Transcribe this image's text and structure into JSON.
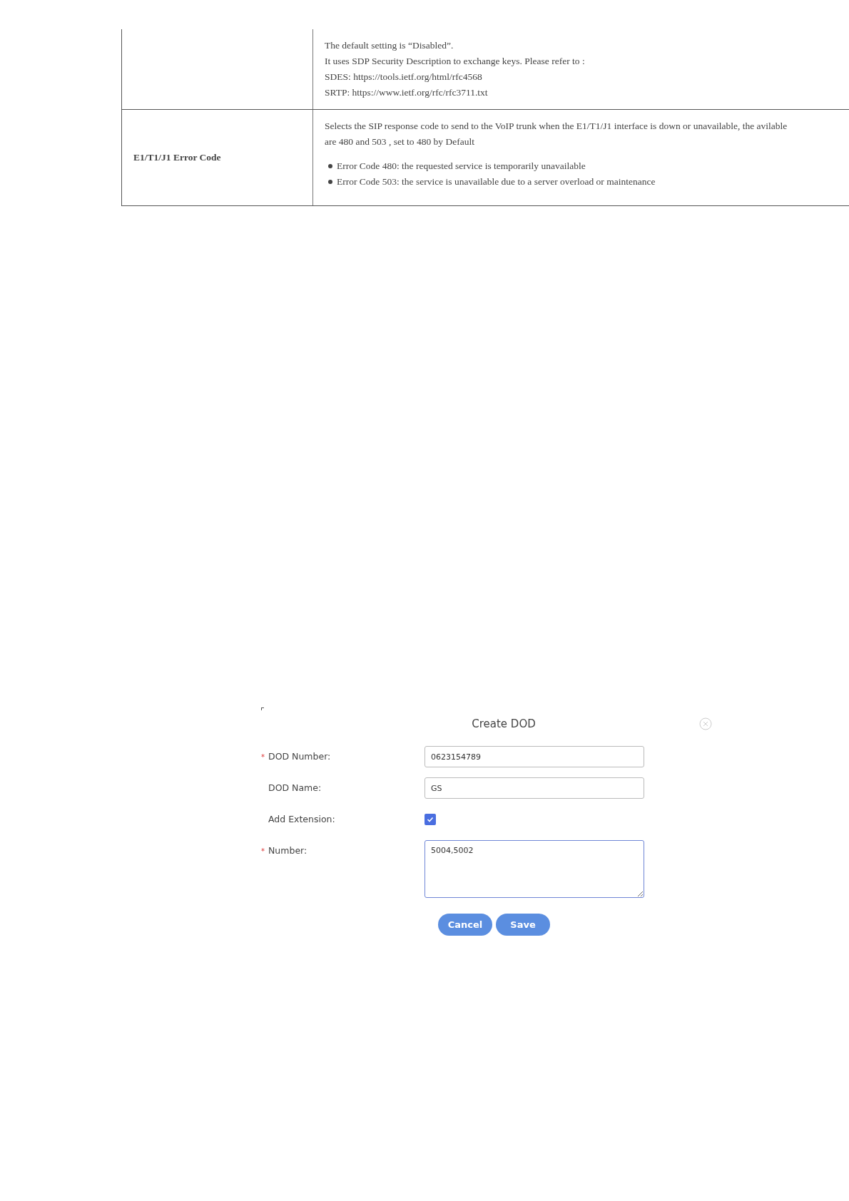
{
  "table": {
    "rows": [
      {
        "name": "",
        "lines": [
          "The default setting is “Disabled”.",
          "It uses SDP Security Description to exchange keys. Please refer to :",
          "SDES: https://tools.ietf.org/html/rfc4568",
          "SRTP: https://www.ietf.org/rfc/rfc3711.txt"
        ],
        "bullets": []
      },
      {
        "name": "E1/T1/J1 Error Code",
        "lines": [
          "Selects the SIP response code to send to the VoIP trunk when the E1/T1/J1 interface is down or unavailable, the avilable",
          "are 480 and 503 , set to 480 by Default"
        ],
        "bullets": [
          "Error Code 480: the requested service is temporarily unavailable",
          "Error Code 503: the service is unavailable due to a server overload or maintenance"
        ]
      }
    ]
  },
  "dialog": {
    "title": "Create DOD",
    "fields": [
      {
        "kind": "input",
        "mark": "*",
        "label": "DOD Number:",
        "value": "0623154789"
      },
      {
        "kind": "input",
        "label": "DOD Name:",
        "value": "GS"
      },
      {
        "kind": "checkbox",
        "label": "Add Extension:",
        "checked": true
      },
      {
        "kind": "textarea",
        "mark": "*",
        "label": "Number:",
        "value": "5004,5002"
      }
    ],
    "buttons": [
      "Cancel",
      "Save"
    ]
  }
}
